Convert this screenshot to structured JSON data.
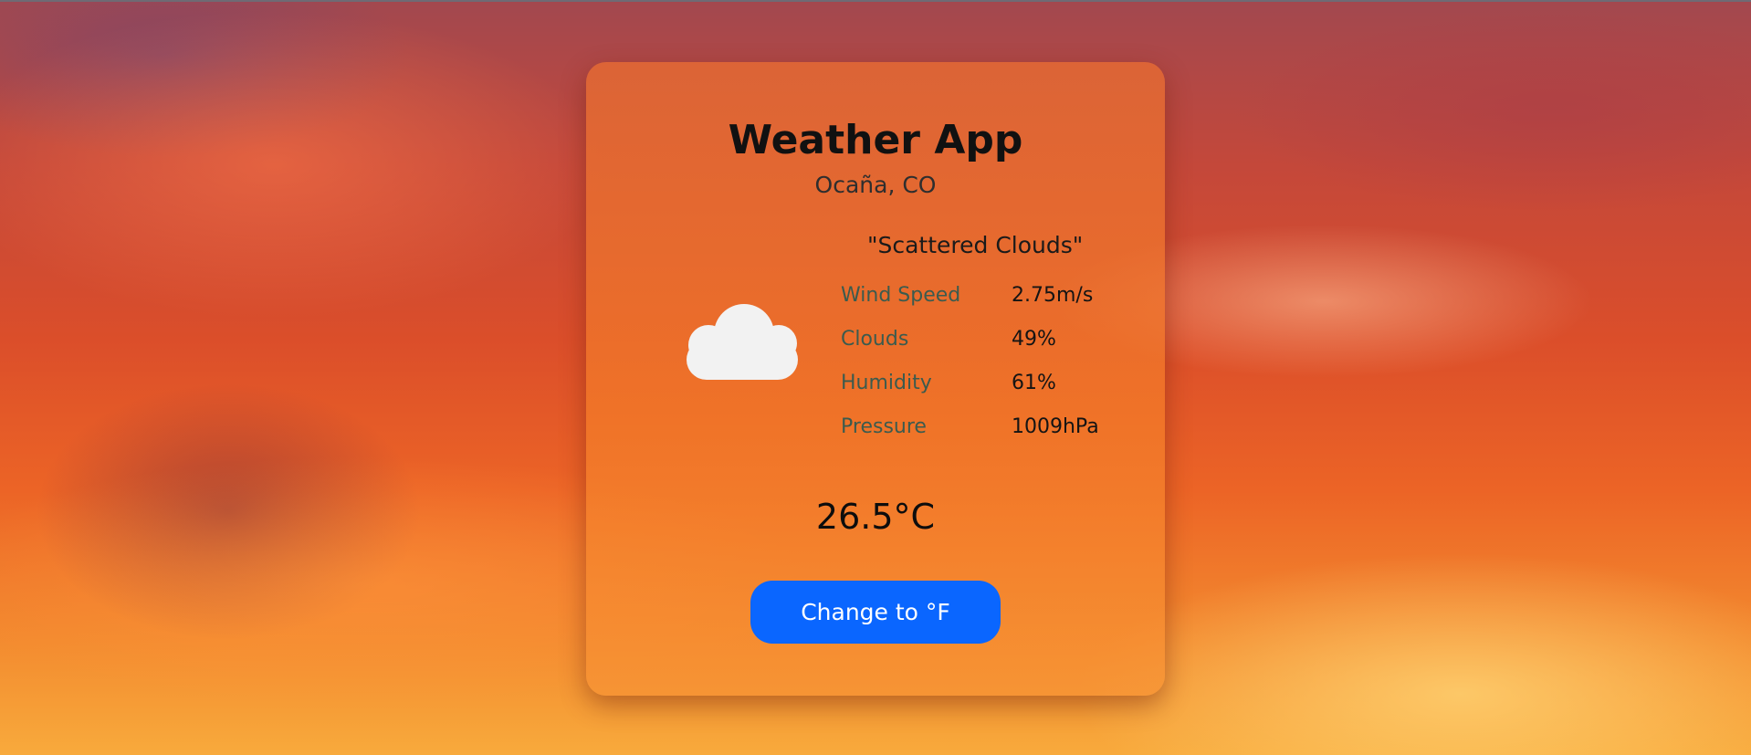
{
  "app": {
    "title": "Weather App",
    "location": "Ocaña, CO"
  },
  "weather": {
    "description": "\"Scattered Clouds\"",
    "icon": "cloud-icon",
    "icon_color": "#f2f2f2",
    "temperature": "26.5°C"
  },
  "stats": [
    {
      "label": "Wind Speed",
      "value": "2.75m/s"
    },
    {
      "label": "Clouds",
      "value": "49%"
    },
    {
      "label": "Humidity",
      "value": "61%"
    },
    {
      "label": "Pressure",
      "value": "1009hPa"
    }
  ],
  "controls": {
    "unit_toggle_label": "Change to °F",
    "button_color": "#0a66ff"
  }
}
